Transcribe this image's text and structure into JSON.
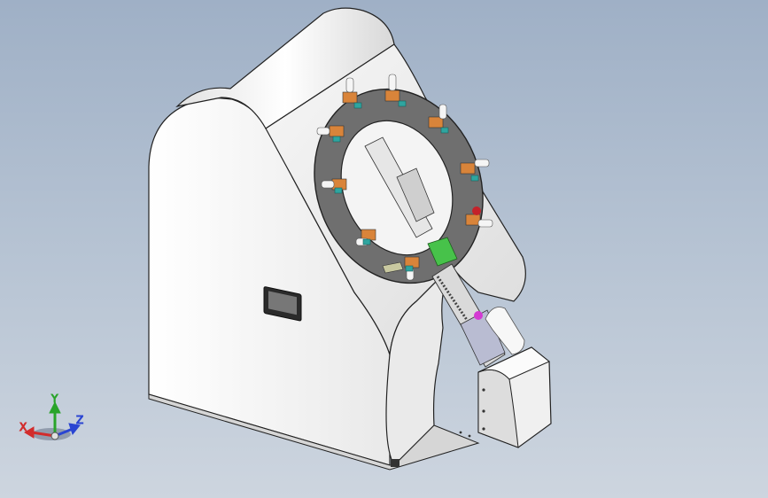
{
  "viewport": {
    "background_top": "#9fb0c6",
    "background_bottom": "#cdd5df"
  },
  "model": {
    "body_color": "#f2f2f2",
    "edge_color": "#222222",
    "ring_color": "#6f6f6f",
    "holder_color": "#d9843a",
    "clamp_color": "#2fa5a0",
    "board_color": "#47c24a",
    "accent_color": "#d43ad2",
    "icon": "sample-loader-machine-icon"
  },
  "triad": {
    "x_label": "X",
    "y_label": "Y",
    "z_label": "Z",
    "x_color": "#d22c2c",
    "y_color": "#2aa42a",
    "z_color": "#2a45d2"
  }
}
